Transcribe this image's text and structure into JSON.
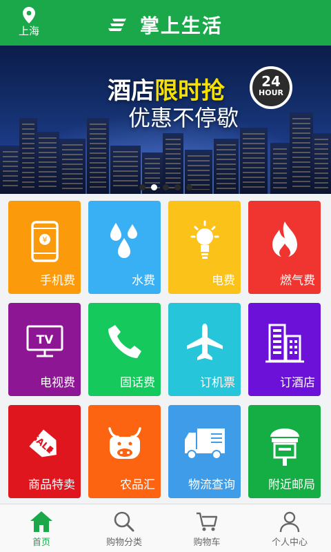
{
  "header": {
    "location": "上海",
    "title": "掌上生活"
  },
  "banner": {
    "line1_a": "酒店",
    "line1_b": "限时抢",
    "line2": "优惠不停歇",
    "badge_number": "24",
    "badge_unit": "HOUR",
    "slide_count": 5,
    "active_slide": 2
  },
  "tiles": [
    {
      "label": "手机费",
      "icon": "mobile-phone-icon",
      "color": "#fb9b0b"
    },
    {
      "label": "水费",
      "icon": "water-drops-icon",
      "color": "#3ab0f4"
    },
    {
      "label": "电费",
      "icon": "light-bulb-icon",
      "color": "#fbc31a"
    },
    {
      "label": "燃气费",
      "icon": "flame-icon",
      "color": "#f0342f"
    },
    {
      "label": "电视费",
      "icon": "tv-icon",
      "color": "#8c1693"
    },
    {
      "label": "固话费",
      "icon": "telephone-icon",
      "color": "#16c95d"
    },
    {
      "label": "订机票",
      "icon": "airplane-icon",
      "color": "#27c5d9"
    },
    {
      "label": "订酒店",
      "icon": "hotel-building-icon",
      "color": "#6b11d8"
    },
    {
      "label": "商品特卖",
      "icon": "sale-tag-icon",
      "color": "#e0161e"
    },
    {
      "label": "农品汇",
      "icon": "cow-icon",
      "color": "#fc6412"
    },
    {
      "label": "物流查询",
      "icon": "delivery-truck-icon",
      "color": "#3e9ce8"
    },
    {
      "label": "附近邮局",
      "icon": "mailbox-icon",
      "color": "#14ae44"
    }
  ],
  "nav": [
    {
      "label": "首页",
      "icon": "home-icon"
    },
    {
      "label": "购物分类",
      "icon": "search-icon"
    },
    {
      "label": "购物车",
      "icon": "cart-icon"
    },
    {
      "label": "个人中心",
      "icon": "user-icon"
    }
  ],
  "colors": {
    "brand_green": "#1aa84b",
    "nav_inactive": "#666666"
  }
}
